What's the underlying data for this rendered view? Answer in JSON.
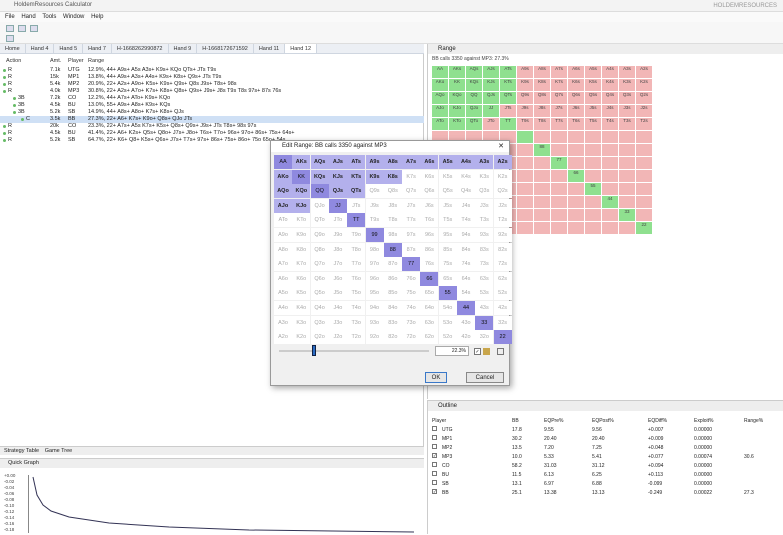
{
  "app": {
    "title": "HoldemResources Calculator",
    "watermark": "HOLDEMRESOURCES"
  },
  "menu": [
    "File",
    "Hand",
    "Tools",
    "Window",
    "Help"
  ],
  "tabs": [
    "Home",
    "Hand 4",
    "Hand 5",
    "Hand 7",
    "H-1668262990872",
    "Hand 9",
    "H-1668172671592",
    "Hand 11",
    "Hand 12"
  ],
  "tree": {
    "headers": {
      "action": "Action",
      "amt": "Amt.",
      "player": "Player",
      "range": "Range"
    },
    "rows": [
      {
        "action": "R",
        "amt": "7.1k",
        "player": "UTG",
        "range": "12.9%, 44+ A9s+ A5s A3s+ K9s+ KQo QTs+ JTs T9s"
      },
      {
        "action": "R",
        "amt": "15k",
        "player": "MP1",
        "range": "13.8%, 44+ A9s+ A3s+ A4s+ K9s+ K8s+ Q9s+ JTs T9s"
      },
      {
        "action": "R",
        "amt": "5.4k",
        "player": "MP2",
        "range": "20.9%, 22+ A2s+ A9o+ K5s+ K9s+ Q9s+ Q8s J9s+ T8s+ 98s"
      },
      {
        "action": "R",
        "amt": "4.0k",
        "player": "MP3",
        "range": "30.8%, 22+ A2s+ A7o+ K7s+ K8s+ Q8s+ Q9s+ J9s+ J8s T9s T8s 97s+ 87s 76s"
      },
      {
        "action": "3B",
        "amt": "7.2k",
        "player": "CO",
        "range": "12.2%, 44+ A7s+ ATo+ K9s+ KQo"
      },
      {
        "action": "3B",
        "amt": "4.5k",
        "player": "BU",
        "range": "13.0%, 55+ A9s+ A8s+ K9s+ KQs"
      },
      {
        "action": "3B",
        "amt": "5.2k",
        "player": "SB",
        "range": "14.9%, 44+ A8s+ A8o+ K7s+ K8s+ QJs"
      },
      {
        "action": "C",
        "amt": "3.5k",
        "player": "BB",
        "range": "27.3%, 22+ A6+ K7s+ K9o+ Q8s+ QJo JTs"
      },
      {
        "action": "R",
        "amt": "20k",
        "player": "CO",
        "range": "23.3%, 22+ A7s+ A5s K7s+ K5s+ Q8s+ Q9s+ J9s+ JTs T8s+ 98s 97s"
      },
      {
        "action": "R",
        "amt": "4.5k",
        "player": "BU",
        "range": "41.4%, 22+ A6+ K2s+ Q5s+ Q8o+ J7s+ J8o+ T6s+ T7o+ 96s+ 97o+ 86s+ 75s+ 64s+"
      },
      {
        "action": "R",
        "amt": "5.2k",
        "player": "SB",
        "range": "64.7%, 22+ K6+ Q8+ K5s+ Q6s+ J7s+ T7s+ 97s+ 86s+ 75s+ 86o+ 75o 65o+ 54s"
      }
    ]
  },
  "bottom_tabs": [
    "Strategy Table",
    "Game Tree"
  ],
  "quick_graph": {
    "title": "Quick Graph",
    "y_ticks": [
      "+0.00",
      "-0.02",
      "-0.04",
      "-0.06",
      "-0.08",
      "-0.10",
      "-0.12",
      "-0.14",
      "-0.16",
      "-0.18"
    ]
  },
  "range_panel": {
    "title": "Range",
    "subtitle": "BB calls 3350 against MP3: 27.3%",
    "mini_rows": [
      [
        "AA",
        "AKs",
        "AQs",
        "AJs",
        "ATs",
        "A9s",
        "A8s",
        "A7s",
        "A6s",
        "A5s",
        "A4s",
        "A3s",
        "A2s"
      ],
      [
        "AKo",
        "KK",
        "KQs",
        "KJs",
        "KTs",
        "K9s",
        "K8s",
        "K7s",
        "K6s",
        "K5s",
        "K4s",
        "K3s",
        "K2s"
      ],
      [
        "AQo",
        "KQo",
        "QQ",
        "QJs",
        "QTs",
        "Q9s",
        "Q8s",
        "Q7s",
        "Q6s",
        "Q5s",
        "Q4s",
        "Q3s",
        "Q2s"
      ],
      [
        "AJo",
        "KJo",
        "QJo",
        "JJ",
        "JTs",
        "J9s",
        "J8s",
        "J7s",
        "J6s",
        "J5s",
        "J4s",
        "J3s",
        "J2s"
      ],
      [
        "ATo",
        "KTo",
        "QTo",
        "JTo",
        "TT",
        "T9s",
        "T8s",
        "T7s",
        "T6s",
        "T5s",
        "T4s",
        "T3s",
        "T2s"
      ]
    ],
    "diag_labels": [
      "88",
      "77",
      "66",
      "55",
      "44",
      "33",
      "22"
    ]
  },
  "outline": {
    "title": "Outline",
    "headers": [
      "Player",
      "BB",
      "EQPre%",
      "EQPost%",
      "EQDiff%",
      "Exploit%",
      "Range%"
    ],
    "rows": [
      {
        "checked": false,
        "player": "UTG",
        "bb": "17.8",
        "pre": "9.55",
        "post": "9.56",
        "diff": "+0.007",
        "exp": "0.00000",
        "range": ""
      },
      {
        "checked": false,
        "player": "MP1",
        "bb": "30.2",
        "pre": "20.40",
        "post": "20.40",
        "diff": "+0.009",
        "exp": "0.00000",
        "range": ""
      },
      {
        "checked": false,
        "player": "MP2",
        "bb": "13.5",
        "pre": "7.20",
        "post": "7.25",
        "diff": "+0.048",
        "exp": "0.00000",
        "range": ""
      },
      {
        "checked": true,
        "player": "MP3",
        "bb": "10.0",
        "pre": "5.33",
        "post": "5.41",
        "diff": "+0.077",
        "exp": "0.00074",
        "range": "30.6"
      },
      {
        "checked": false,
        "player": "CO",
        "bb": "58.2",
        "pre": "31.03",
        "post": "31.12",
        "diff": "+0.094",
        "exp": "0.00000",
        "range": ""
      },
      {
        "checked": false,
        "player": "BU",
        "bb": "11.5",
        "pre": "6.13",
        "post": "6.25",
        "diff": "+0.113",
        "exp": "0.00000",
        "range": ""
      },
      {
        "checked": false,
        "player": "SB",
        "bb": "13.1",
        "pre": "6.97",
        "post": "6.88",
        "diff": "-0.099",
        "exp": "0.00000",
        "range": ""
      },
      {
        "checked": true,
        "player": "BB",
        "bb": "25.1",
        "pre": "13.38",
        "post": "13.13",
        "diff": "-0.249",
        "exp": "0.00022",
        "range": "27.3"
      }
    ]
  },
  "dialog": {
    "title": "Edit Range: BB calls 3350 against MP3",
    "close": "✕",
    "percent": "22.3%",
    "ok": "OK",
    "cancel": "Cancel",
    "grid": [
      [
        "AA",
        "AKs",
        "AQs",
        "AJs",
        "ATs",
        "A9s",
        "A8s",
        "A7s",
        "A6s",
        "A5s",
        "A4s",
        "A3s",
        "A2s"
      ],
      [
        "AKo",
        "KK",
        "KQs",
        "KJs",
        "KTs",
        "K9s",
        "K8s",
        "K7s",
        "K6s",
        "K5s",
        "K4s",
        "K3s",
        "K2s"
      ],
      [
        "AQo",
        "KQo",
        "QQ",
        "QJs",
        "QTs",
        "Q9s",
        "Q8s",
        "Q7s",
        "Q6s",
        "Q5s",
        "Q4s",
        "Q3s",
        "Q2s"
      ],
      [
        "AJo",
        "KJo",
        "QJo",
        "JJ",
        "JTs",
        "J9s",
        "J8s",
        "J7s",
        "J6s",
        "J5s",
        "J4s",
        "J3s",
        "J2s"
      ],
      [
        "ATo",
        "KTo",
        "QTo",
        "JTo",
        "TT",
        "T9s",
        "T8s",
        "T7s",
        "T6s",
        "T5s",
        "T4s",
        "T3s",
        "T2s"
      ],
      [
        "A9o",
        "K9o",
        "Q9o",
        "J9o",
        "T9o",
        "99",
        "98s",
        "97s",
        "96s",
        "95s",
        "94s",
        "93s",
        "92s"
      ],
      [
        "A8o",
        "K8o",
        "Q8o",
        "J8o",
        "T8o",
        "98o",
        "88",
        "87s",
        "86s",
        "85s",
        "84s",
        "83s",
        "82s"
      ],
      [
        "A7o",
        "K7o",
        "Q7o",
        "J7o",
        "T7o",
        "97o",
        "87o",
        "77",
        "76s",
        "75s",
        "74s",
        "73s",
        "72s"
      ],
      [
        "A6o",
        "K6o",
        "Q6o",
        "J6o",
        "T6o",
        "96o",
        "86o",
        "76o",
        "66",
        "65s",
        "64s",
        "63s",
        "62s"
      ],
      [
        "A5o",
        "K5o",
        "Q5o",
        "J5o",
        "T5o",
        "95o",
        "85o",
        "75o",
        "65o",
        "55",
        "54s",
        "53s",
        "52s"
      ],
      [
        "A4o",
        "K4o",
        "Q4o",
        "J4o",
        "T4o",
        "94o",
        "84o",
        "74o",
        "64o",
        "54o",
        "44",
        "43s",
        "42s"
      ],
      [
        "A3o",
        "K3o",
        "Q3o",
        "J3o",
        "T3o",
        "93o",
        "83o",
        "73o",
        "63o",
        "53o",
        "43o",
        "33",
        "32s"
      ],
      [
        "A2o",
        "K2o",
        "Q2o",
        "J2o",
        "T2o",
        "92o",
        "82o",
        "72o",
        "62o",
        "52o",
        "42o",
        "32o",
        "22"
      ]
    ],
    "selected": [
      "AA",
      "AKs",
      "AQs",
      "AJs",
      "ATs",
      "A9s",
      "A8s",
      "A7s",
      "A6s",
      "A5s",
      "A4s",
      "A3s",
      "A2s",
      "AKo",
      "KK",
      "KQs",
      "KJs",
      "KTs",
      "K9s",
      "K8s",
      "AQo",
      "KQo",
      "QQ",
      "QJs",
      "QTs",
      "AJo",
      "KJo",
      "JJ",
      "TT",
      "99",
      "88",
      "77",
      "66",
      "55",
      "44",
      "33",
      "22"
    ],
    "slider_value": 0.22
  }
}
